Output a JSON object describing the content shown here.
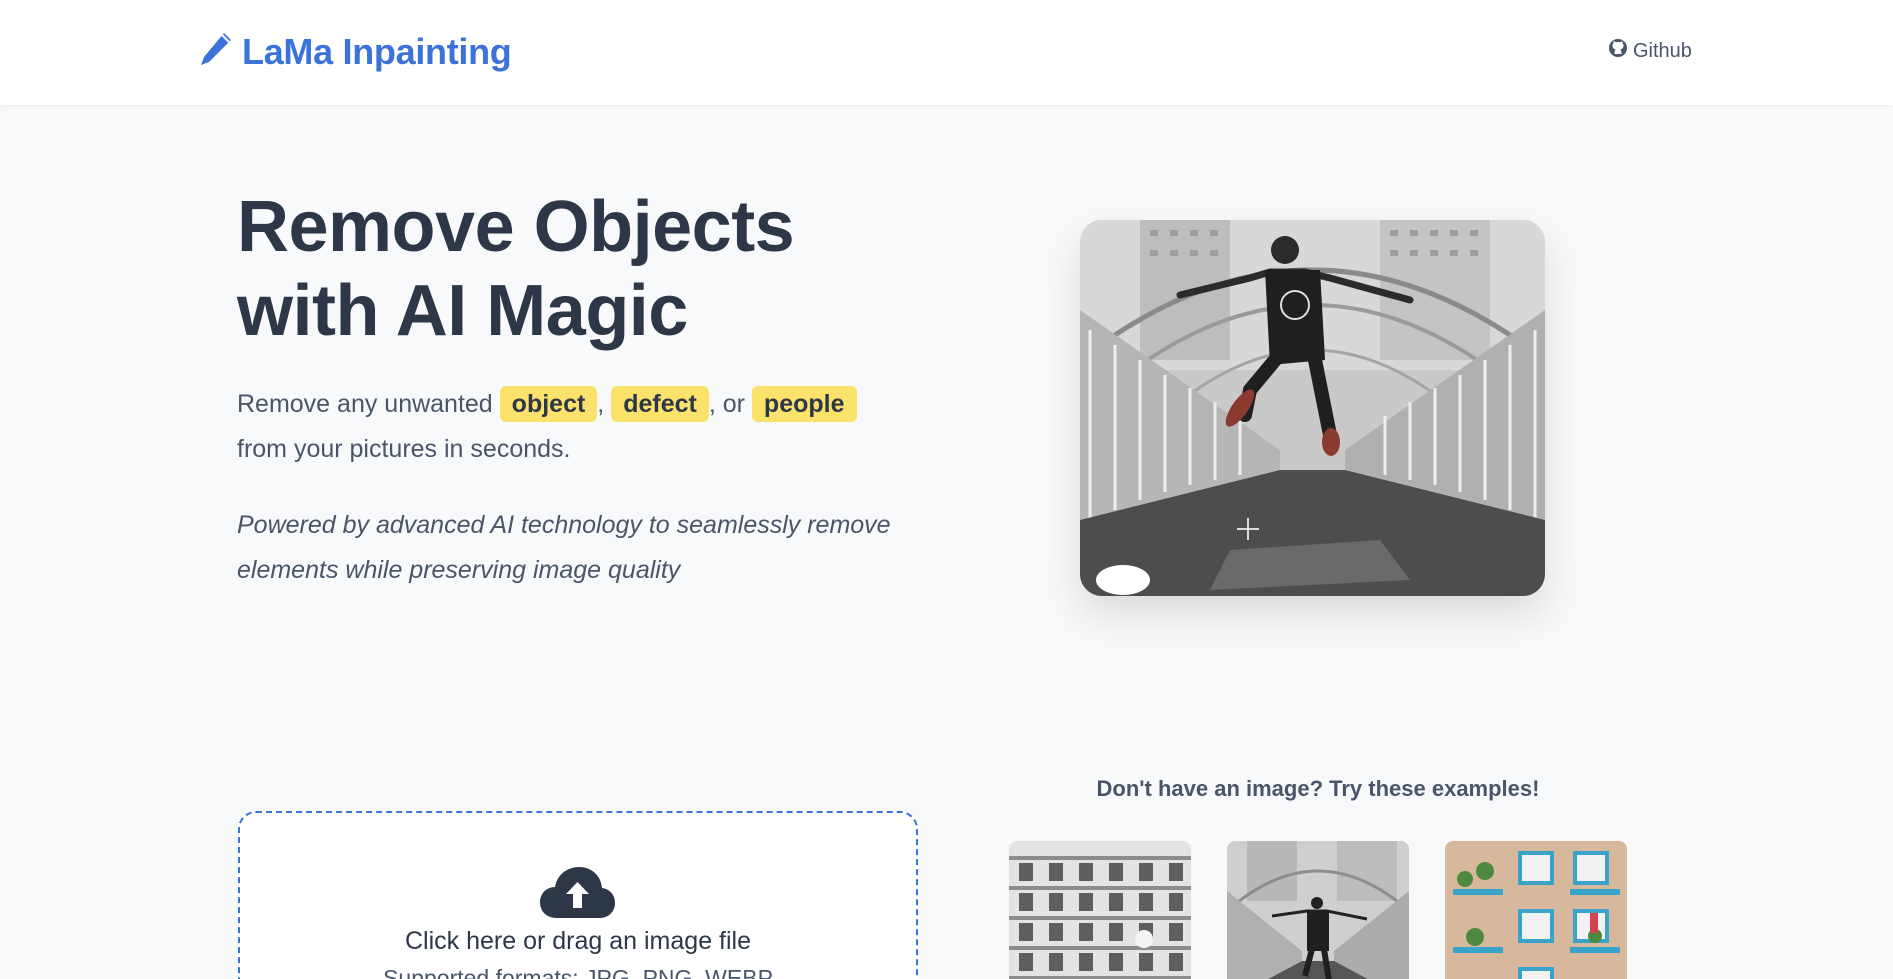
{
  "header": {
    "logo_text": "LaMa Inpainting",
    "logo_icon": "pencil-icon",
    "github_label": "Github",
    "github_icon": "github-icon"
  },
  "hero": {
    "title": "Remove Objects with AI Magic",
    "subtitle_prefix": "Remove any unwanted",
    "highlight_1": "object",
    "sep_1": ",",
    "highlight_2": "defect",
    "sep_2": ", or",
    "highlight_3": "people",
    "subtitle_suffix": "from your pictures in seconds.",
    "note": "Powered by advanced AI technology to seamlessly remove elements while preserving image quality"
  },
  "upload": {
    "icon": "cloud-upload-icon",
    "main_text": "Click here or drag an image file",
    "formats_text": "Supported formats: JPG, PNG, WEBP"
  },
  "examples": {
    "title": "Don't have an image? Try these examples!"
  },
  "colors": {
    "accent": "#3b73d9",
    "highlight": "#fbe26b",
    "text": "#2d3748",
    "background": "#f8f9fb"
  }
}
